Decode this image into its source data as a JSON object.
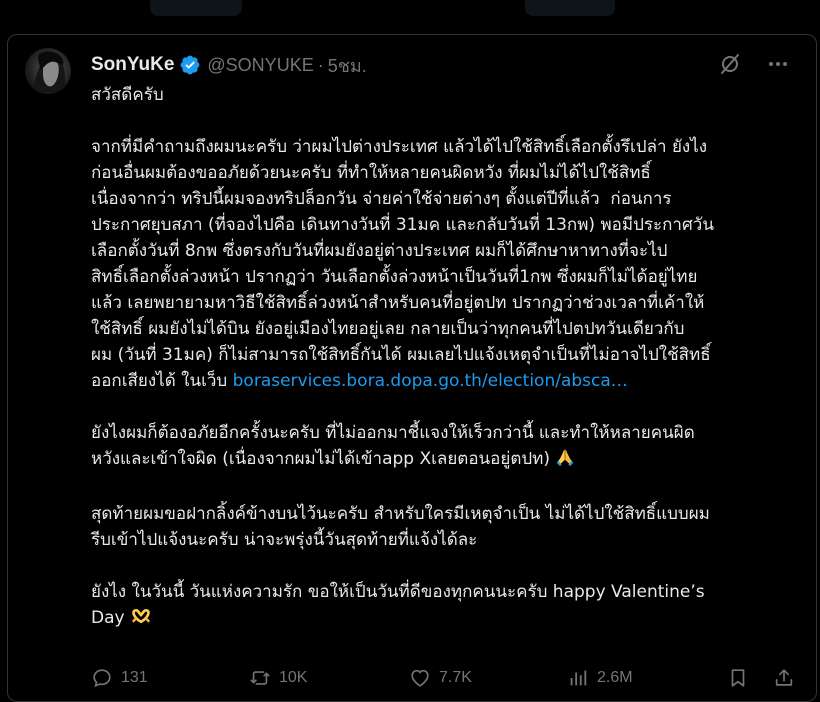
{
  "author": {
    "display_name": "SonYuKe",
    "handle": "@SONYUKE",
    "separator": "·",
    "time": "5ชม."
  },
  "post": {
    "greeting": "สวัสดีครับ",
    "paragraph1": [
      "จากที่มีคำถามถึงผมนะครับ ว่าผมไปต่างประเทศ แล้วได้ไปใช้สิทธิ์เลือกตั้งรึเปล่า ยังไง",
      "ก่อนอื่นผมต้องขออภัยด้วยนะครับ ที่ทำให้หลายคนผิดหวัง ที่ผมไม่ได้ไปใช้สิทธิ์",
      "เนื่องจากว่า ทริปนี้ผมจองทริปล็อกวัน จ่ายค่าใช้จ่ายต่างๆ ตั้งแต่ปีที่แล้ว  ก่อนการ",
      "ประกาศยุบสภา (ที่จองไปคือ เดินทางวันที่ 31มค และกลับวันที่ 13กพ) พอมีประกาศวัน",
      "เลือกตั้งวันที่ 8กพ ซึ่งตรงกับวันที่ผมยังอยู่ต่างประเทศ ผมก็ได้ศึกษาหาทางที่จะไป",
      "สิทธิ์เลือกตั้งล่วงหน้า ปรากฏว่า วันเลือกตั้งล่วงหน้าเป็นวันที่1กพ ซึ่งผมก็ไม่ได้อยู่ไทย",
      "แล้ว เลยพยายามหาวิธีใช้สิทธิ์ล่วงหน้าสำหรับคนที่อยู่ตปท ปรากฏว่าช่วงเวลาที่เค้าให้",
      "ใช้สิทธิ์ ผมยังไม่ได้บิน ยังอยู่เมืองไทยอยู่เลย กลายเป็นว่าทุกคนที่ไปตปทวันเดียวกับ",
      "ผม (วันที่ 31มค) ก็ไม่สามารถใช้สิทธิ์กันได้ ผมเลยไปแจ้งเหตุจำเป็นที่ไม่อาจไปใช้สิทธิ์"
    ],
    "paragraph1_last_prefix": "ออกเสียงได้ ในเว็บ ",
    "link_text": "boraservices.bora.dopa.go.th/election/absca…",
    "paragraph2": [
      "ยังไงผมก็ต้องอภัยอีกครั้งนะครับ ที่ไม่ออกมาชี้แจงให้เร็วกว่านี้ และทำให้หลายคนผิด"
    ],
    "paragraph2_last": "หวังและเข้าใจผิด (เนื่องจากผมไม่ได้เข้าapp Xเลยตอนอยู่ตปท) ",
    "paragraph3": [
      "สุดท้ายผมขอฝากลิ้งค์ข้างบนไว้นะครับ สำหรับใครมีเหตุจำเป็น ไม่ได้ไปใช้สิทธิ์แบบผม",
      "รีบเข้าไปแจ้งนะครับ น่าจะพรุ่งนี้วันสุดท้ายที่แจ้งได้ละ"
    ],
    "paragraph4_line1": "ยังไง ในวันนี้ วันแห่งความรัก ขอให้เป็นวันที่ดีของทุกคนนะครับ happy Valentine’s",
    "paragraph4_line2": "Day "
  },
  "stats": {
    "replies": "131",
    "reposts": "10K",
    "likes": "7.7K",
    "views": "2.6M"
  },
  "colors": {
    "background": "#000000",
    "text": "#e7e9ea",
    "muted": "#71767b",
    "link": "#1d9bf0",
    "verified": "#1d9bf0",
    "border": "#2f3336"
  },
  "icons": {
    "verified": "verified-badge-icon",
    "grok": "grok-icon",
    "more": "more-icon",
    "reply": "reply-icon",
    "repost": "repost-icon",
    "like": "heart-icon",
    "views": "views-icon",
    "bookmark": "bookmark-icon",
    "share": "share-icon",
    "pray_emoji": "pray-emoji-icon",
    "heart_hands_emoji": "heart-hands-emoji-icon"
  }
}
